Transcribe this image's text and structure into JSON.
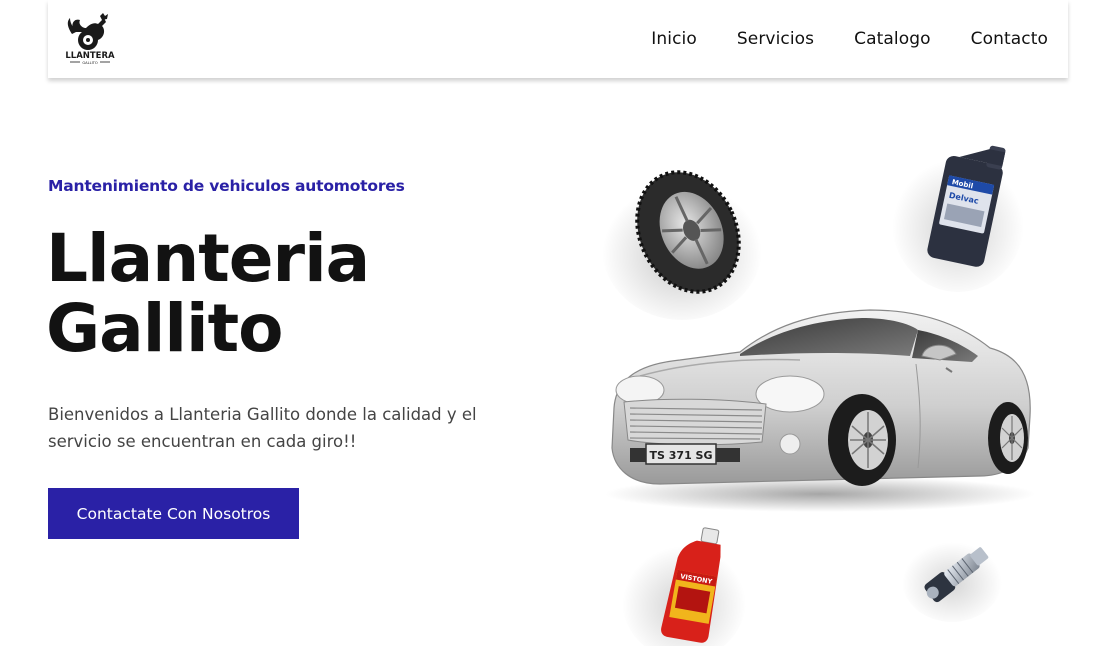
{
  "brand": {
    "logo_text": "LLANTERA",
    "logo_subtext": "GALLITO"
  },
  "nav": {
    "items": [
      {
        "label": "Inicio"
      },
      {
        "label": "Servicios"
      },
      {
        "label": "Catalogo"
      },
      {
        "label": "Contacto"
      }
    ]
  },
  "hero": {
    "eyebrow": "Mantenimiento de vehiculos automotores",
    "title_line1": "Llanteria",
    "title_line2": "Gallito",
    "description": "Bienvenidos a Llanteria Gallito donde la calidad y el servicio se encuentran en cada giro!!",
    "cta_label": "Contactate Con Nosotros"
  },
  "images": {
    "car_plate": "TS 371 SG",
    "oil_brand": "Mobil",
    "oil_product": "Delvac",
    "additive_brand": "VISTONY"
  },
  "colors": {
    "accent": "#2a21a6",
    "text_dark": "#121212",
    "text_body": "#444444"
  }
}
